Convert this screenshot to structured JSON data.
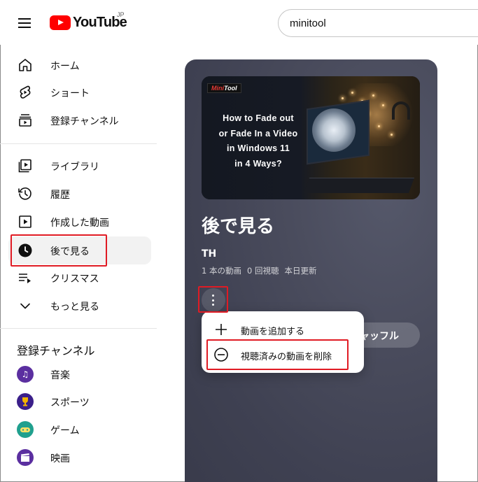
{
  "header": {
    "logo_text": "YouTube",
    "logo_region": "JP",
    "search_value": "minitool"
  },
  "sidebar": {
    "items": [
      {
        "label": "ホーム",
        "icon": "home-icon"
      },
      {
        "label": "ショート",
        "icon": "shorts-icon"
      },
      {
        "label": "登録チャンネル",
        "icon": "subscriptions-icon"
      },
      {
        "label": "ライブラリ",
        "icon": "library-icon"
      },
      {
        "label": "履歴",
        "icon": "history-icon"
      },
      {
        "label": "作成した動画",
        "icon": "your-videos-icon"
      },
      {
        "label": "後で見る",
        "icon": "watch-later-icon",
        "active": true
      },
      {
        "label": "クリスマス",
        "icon": "playlist-icon"
      },
      {
        "label": "もっと見る",
        "icon": "chevron-down-icon"
      }
    ],
    "subscriptions_title": "登録チャンネル",
    "channels": [
      {
        "label": "音楽",
        "icon": "music-icon",
        "color": "#5b2fa0"
      },
      {
        "label": "スポーツ",
        "icon": "trophy-icon",
        "color": "#3b1f8a"
      },
      {
        "label": "ゲーム",
        "icon": "gamepad-icon",
        "color": "#20a08e"
      },
      {
        "label": "映画",
        "icon": "clapperboard-icon",
        "color": "#5b2fa0"
      }
    ]
  },
  "playlist": {
    "thumbnail_brand_mini": "Mini",
    "thumbnail_brand_tool": "Tool",
    "thumbnail_title": "How to Fade out\nor Fade In a Video\nin Windows 11\nin 4 Ways?",
    "title": "後で見る",
    "owner": "TH",
    "video_count": "1 本の動画",
    "views": "0 回視聴",
    "updated": "本日更新",
    "shuffle_label": "ャッフル"
  },
  "menu": {
    "items": [
      {
        "label": "動画を追加する",
        "icon": "plus-icon"
      },
      {
        "label": "視聴済みの動画を削除",
        "icon": "remove-circle-icon"
      }
    ]
  },
  "colors": {
    "accent": "#ff0000",
    "highlight": "#e01b24",
    "panel": "#45475a"
  }
}
